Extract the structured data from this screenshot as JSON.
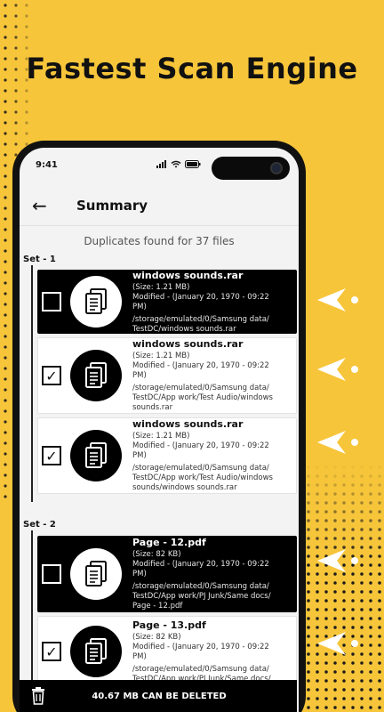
{
  "headline": "Fastest Scan Engine",
  "status": {
    "time": "9:41"
  },
  "appbar": {
    "title": "Summary"
  },
  "summary_text": "Duplicates found for 37 files",
  "sets": [
    {
      "label": "Set - 1",
      "files": [
        {
          "name": "windows sounds.rar",
          "size": "(Size: 1.21 MB)",
          "modified": "Modified - (January 20, 1970 - 09:22 PM)",
          "path": "/storage/emulated/0/Samsung data/ TestDC/windows sounds.rar",
          "checked": false,
          "highlighted": true
        },
        {
          "name": "windows sounds.rar",
          "size": "(Size: 1.21 MB)",
          "modified": "Modified - (January 20, 1970 - 09:22 PM)",
          "path": "/storage/emulated/0/Samsung data/ TestDC/App work/Test Audio/windows sounds.rar",
          "checked": true,
          "highlighted": false
        },
        {
          "name": "windows sounds.rar",
          "size": "(Size: 1.21 MB)",
          "modified": "Modified - (January 20, 1970 - 09:22 PM)",
          "path": "/storage/emulated/0/Samsung data/ TestDC/App work/Test Audio/windows sounds/windows sounds.rar",
          "checked": true,
          "highlighted": false
        }
      ]
    },
    {
      "label": "Set - 2",
      "files": [
        {
          "name": "Page - 12.pdf",
          "size": "(Size: 82 KB)",
          "modified": "Modified - (January 20, 1970 - 09:22 PM)",
          "path": "/storage/emulated/0/Samsung data/ TestDC/App work/PJ Junk/Same docs/ Page - 12.pdf",
          "checked": false,
          "highlighted": true
        },
        {
          "name": "Page - 13.pdf",
          "size": "(Size: 82 KB)",
          "modified": "Modified - (January 20, 1970 - 09:22 PM)",
          "path": "/storage/emulated/0/Samsung data/ TestDC/App work/PJ Junk/Same docs/",
          "checked": true,
          "highlighted": false
        }
      ]
    }
  ],
  "bottom_bar": {
    "text": "40.67 MB CAN BE DELETED"
  },
  "icons": {
    "back": "arrow-left-icon",
    "file": "document-copy-icon",
    "trash": "trash-icon",
    "checkmark": "checkmark-icon",
    "pointer": "arrow-pointer-icon"
  },
  "colors": {
    "background": "#f7c53a",
    "dark": "#000000",
    "card": "#ffffff"
  }
}
